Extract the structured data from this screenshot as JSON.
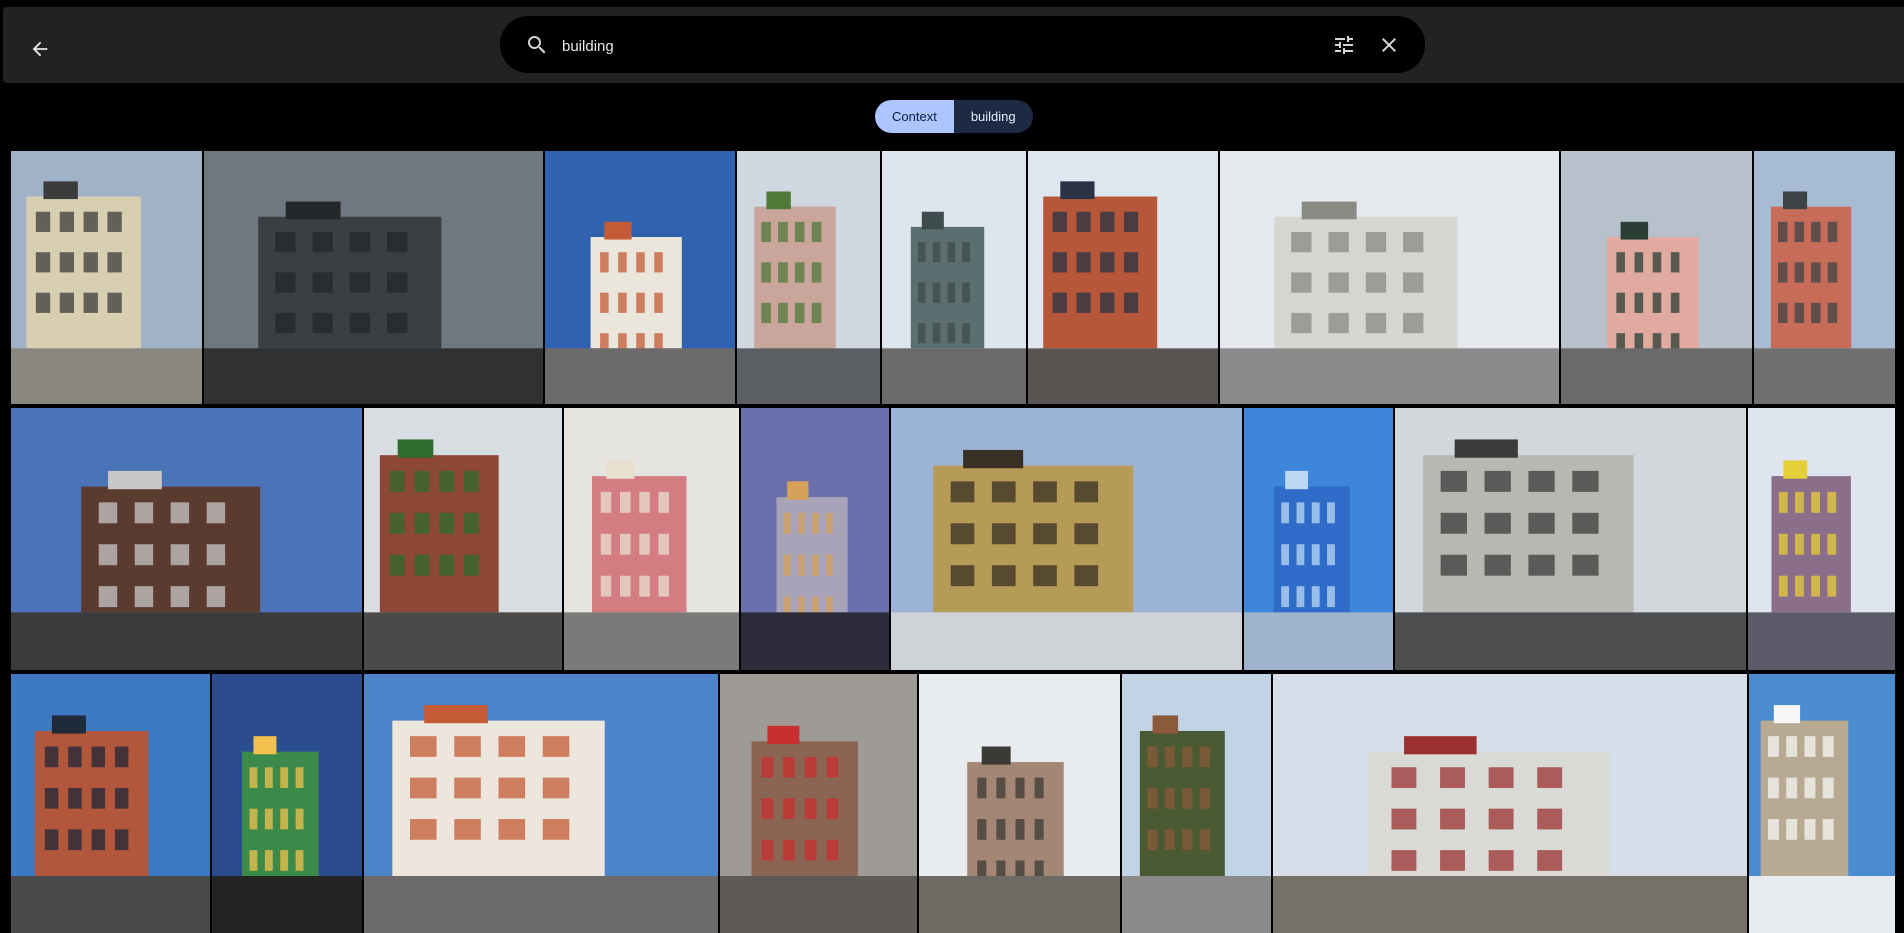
{
  "header": {
    "back_icon": "arrow-back-icon",
    "search": {
      "icon": "search-icon",
      "value": "building",
      "placeholder": "",
      "filter_icon": "tune-icon",
      "clear_icon": "close-icon"
    }
  },
  "chips": {
    "context_label": "Context",
    "query_label": "building",
    "colors": {
      "context_bg": "#adc6ff",
      "query_bg": "#1d2a44"
    }
  },
  "results": {
    "icon": "photo-thumbnail",
    "rows": [
      [
        {
          "sky": "#9fb2c8",
          "ground": "#8a8680",
          "building": "#d8cfb2",
          "accent": "#3b3b3b"
        },
        {
          "sky": "#6f7880",
          "ground": "#2f3133",
          "building": "#3a3f44",
          "accent": "#24282b"
        },
        {
          "sky": "#2f63b0",
          "ground": "#6d6b69",
          "building": "#eae6dc",
          "accent": "#c55a36"
        },
        {
          "sky": "#cfd8e0",
          "ground": "#5b5e62",
          "building": "#c9a59b",
          "accent": "#4f7a3a"
        },
        {
          "sky": "#dde5ee",
          "ground": "#6a6a6a",
          "building": "#5b6e70",
          "accent": "#3f4c4e"
        },
        {
          "sky": "#dfe6ef",
          "ground": "#5a5553",
          "building": "#b6573a",
          "accent": "#2a3345"
        },
        {
          "sky": "#e5e9ee",
          "ground": "#8a8a8a",
          "building": "#d6d6d0",
          "accent": "#8a8a84"
        },
        {
          "sky": "#b6c1cc",
          "ground": "#6a6a6a",
          "building": "#e0aaa0",
          "accent": "#2a3e35"
        },
        {
          "sky": "#a8bbd4",
          "ground": "#707070",
          "building": "#c86c5a",
          "accent": "#3e4446"
        }
      ],
      [
        {
          "sky": "#4a73b8",
          "ground": "#3b3b3b",
          "building": "#5b3b30",
          "accent": "#c8c8c8"
        },
        {
          "sky": "#d8dde2",
          "ground": "#4b4a48",
          "building": "#8d4736",
          "accent": "#2f6b2c"
        },
        {
          "sky": "#e6e4e0",
          "ground": "#7b7a78",
          "building": "#d37c82",
          "accent": "#e8e0cc"
        },
        {
          "sky": "#6a6fae",
          "ground": "#2c2c3a",
          "building": "#a8a3b8",
          "accent": "#d6a25a"
        },
        {
          "sky": "#9cb3d8",
          "ground": "#cfd3d8",
          "building": "#b59b56",
          "accent": "#3a2f25"
        },
        {
          "sky": "#3e86d9",
          "ground": "#9fb4cc",
          "building": "#2f6bc8",
          "accent": "#bcd8f4"
        },
        {
          "sky": "#d3d6da",
          "ground": "#4d4e50",
          "building": "#b8b8b2",
          "accent": "#3b3b3b"
        },
        {
          "sky": "#dfe5ee",
          "ground": "#5b5b6a",
          "building": "#8a6e8a",
          "accent": "#e6d03a"
        }
      ],
      [
        {
          "sky": "#3d7ac2",
          "ground": "#4a4a4a",
          "building": "#b2563c",
          "accent": "#1f2a3a"
        },
        {
          "sky": "#2b4d8f",
          "ground": "#232323",
          "building": "#3c8a4a",
          "accent": "#f2c14e"
        },
        {
          "sky": "#4c83c9",
          "ground": "#6b6a68",
          "building": "#ece6dc",
          "accent": "#c55a36"
        },
        {
          "sky": "#9e9a96",
          "ground": "#5e5a56",
          "building": "#8a6553",
          "accent": "#c82f2f"
        },
        {
          "sky": "#e9ecef",
          "ground": "#6d6a64",
          "building": "#a48674",
          "accent": "#3c3a36"
        },
        {
          "sky": "#c3d3e6",
          "ground": "#8a8a88",
          "building": "#4a5a32",
          "accent": "#8a5a3a"
        },
        {
          "sky": "#d5dde8",
          "ground": "#757068",
          "building": "#d9d9d5",
          "accent": "#9a3030"
        },
        {
          "sky": "#4b8bd0",
          "ground": "#e8ecf0",
          "building": "#b8aa92",
          "accent": "#f6f6f6"
        }
      ]
    ]
  }
}
